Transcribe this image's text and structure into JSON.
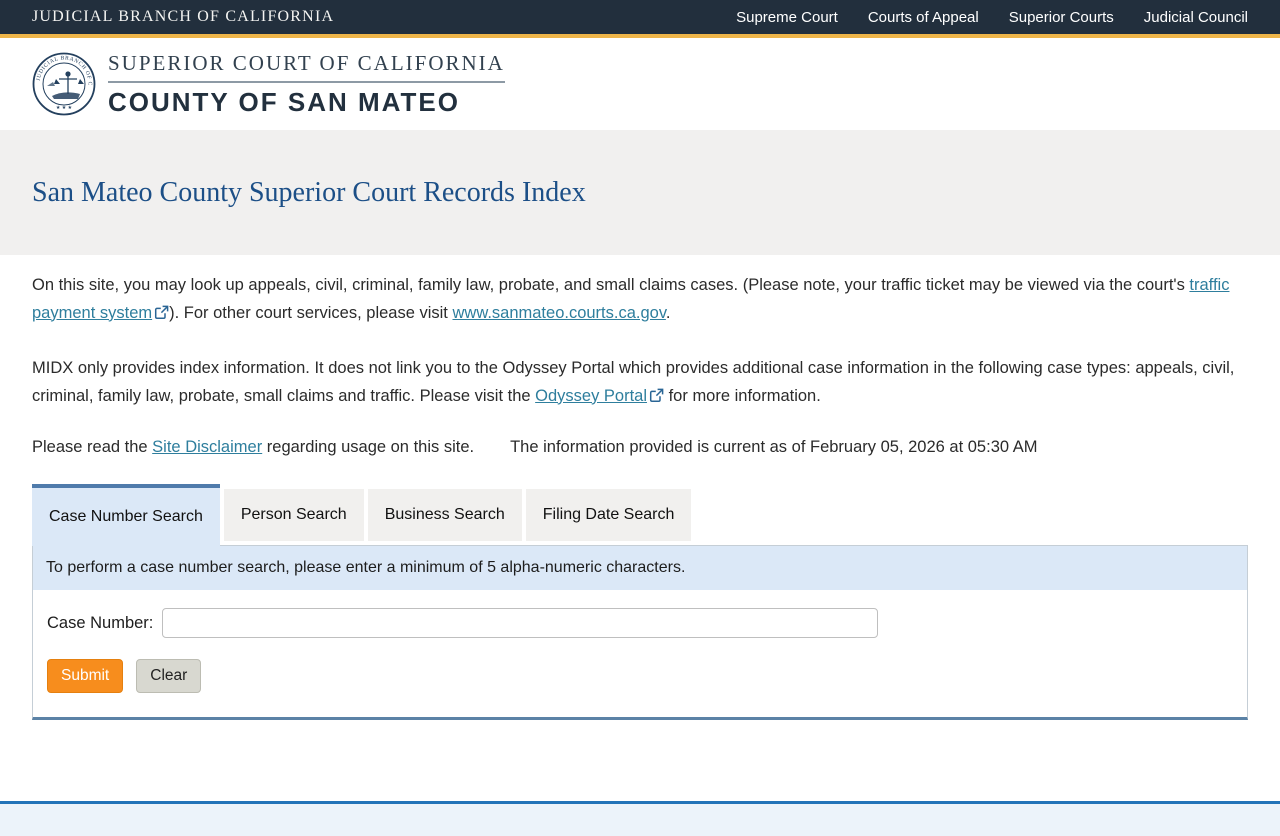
{
  "topbar": {
    "brand": "JUDICIAL BRANCH OF CALIFORNIA",
    "links": [
      {
        "label": "Supreme Court"
      },
      {
        "label": "Courts of Appeal"
      },
      {
        "label": "Superior Courts"
      },
      {
        "label": "Judicial Council"
      }
    ]
  },
  "header": {
    "seal_icon": "judicial-branch-of-california-seal",
    "line1": "SUPERIOR COURT OF CALIFORNIA",
    "line2": "COUNTY OF SAN MATEO"
  },
  "page": {
    "title": "San Mateo County Superior Court Records Index"
  },
  "intro": {
    "p1_before": "On this site, you may look up appeals, civil, criminal, family law, probate, and small claims cases. (Please note, your traffic ticket may be viewed via the court's ",
    "p1_link1": "traffic payment system",
    "p1_mid": "). For other court services, please visit ",
    "p1_link2": "www.sanmateo.courts.ca.gov",
    "p1_end": ".",
    "p2_before": "MIDX only provides index information. It does not link you to the Odyssey Portal which provides additional case information in the following case types: appeals, civil, criminal, family law, probate, small claims and traffic. Please visit the ",
    "p2_link": "Odyssey Portal",
    "p2_after": " for more information.",
    "disclaimer_before": "Please read the ",
    "disclaimer_link": "Site Disclaimer",
    "disclaimer_after": " regarding usage on this site.",
    "current_info": "The information provided is current as of February 05, 2026 at 05:30 AM"
  },
  "tabs": [
    {
      "label": "Case Number Search",
      "active": true
    },
    {
      "label": "Person Search",
      "active": false
    },
    {
      "label": "Business Search",
      "active": false
    },
    {
      "label": "Filing Date Search",
      "active": false
    }
  ],
  "search_panel": {
    "instruction": "To perform a case number search, please enter a minimum of 5 alpha-numeric characters.",
    "case_number_label": "Case Number:",
    "case_number_value": "",
    "submit_label": "Submit",
    "clear_label": "Clear"
  },
  "colors": {
    "topbar_bg": "#222f3d",
    "gold_accent": "#eeb549",
    "title_blue": "#1c4f87",
    "link_teal": "#2e7e9d",
    "active_tab_border": "#4f7bab",
    "active_tab_bg": "#dbe8f7",
    "panel_bottom_border": "#5b82a6",
    "submit_orange": "#f78d1d",
    "footer_blue": "#2273b8",
    "footer_bg": "#ecf3fa"
  }
}
